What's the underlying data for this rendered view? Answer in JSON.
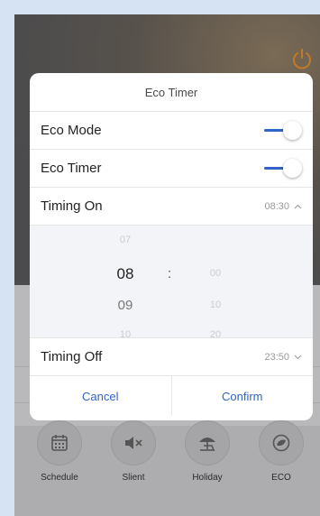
{
  "dialog": {
    "title": "Eco Timer",
    "eco_mode_label": "Eco Mode",
    "eco_mode_on": true,
    "eco_timer_label": "Eco Timer",
    "eco_timer_on": true,
    "timing_on_label": "Timing On",
    "timing_on_value": "08:30",
    "timing_off_label": "Timing Off",
    "timing_off_value": "23:50",
    "picker": {
      "hours": [
        "07",
        "08",
        "09",
        "10"
      ],
      "selected_hour": "08",
      "separator": ":",
      "minutes": [
        "00",
        "10",
        "20"
      ]
    },
    "cancel_label": "Cancel",
    "confirm_label": "Confirm"
  },
  "bottom_bar": [
    {
      "label": "Schedule",
      "icon": "calendar-icon"
    },
    {
      "label": "Slient",
      "icon": "mute-icon"
    },
    {
      "label": "Holiday",
      "icon": "beach-umbrella-icon"
    },
    {
      "label": "ECO",
      "icon": "eco-leaf-icon"
    }
  ],
  "colors": {
    "accent": "#2f64c8",
    "background": "#4b4b4d",
    "dialog": "#ffffff"
  }
}
